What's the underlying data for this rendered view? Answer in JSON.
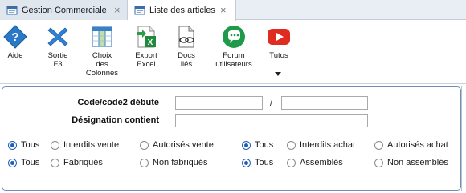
{
  "tabs": [
    {
      "label": "Gestion Commerciale",
      "icon": "app-window-icon",
      "close": "×"
    },
    {
      "label": "Liste des articles",
      "icon": "list-icon",
      "close": "×"
    }
  ],
  "toolbar": {
    "items": [
      {
        "label": "Aide",
        "icon": "help-diamond-icon"
      },
      {
        "label": "Sortie\nF3",
        "icon": "exit-x-icon"
      },
      {
        "label": "Choix\ndes\nColonnes",
        "icon": "columns-icon"
      },
      {
        "label": "Export\nExcel",
        "icon": "excel-export-icon"
      },
      {
        "label": "Docs\nliés",
        "icon": "linked-docs-icon"
      },
      {
        "label": "Forum\nutilisateurs",
        "icon": "forum-icon"
      },
      {
        "label": "Tutos",
        "icon": "youtube-icon"
      }
    ]
  },
  "filters": {
    "code_label": "Code/code2 débute",
    "code_from_value": "",
    "code_separator": "/",
    "code_to_value": "",
    "designation_label": "Désignation contient",
    "designation_value": ""
  },
  "radio_groups": {
    "row1_left": [
      "Tous",
      "Interdits vente",
      "Autorisés vente"
    ],
    "row1_right": [
      "Tous",
      "Interdits achat",
      "Autorisés achat"
    ],
    "row2_left": [
      "Tous",
      "Fabriqués",
      "Non fabriqués"
    ],
    "row2_right": [
      "Tous",
      "Assemblés",
      "Non assemblés"
    ]
  },
  "colors": {
    "accent": "#1d5fb8",
    "panel_border": "#6f8db5",
    "tab_bar": "#e9eef4"
  }
}
